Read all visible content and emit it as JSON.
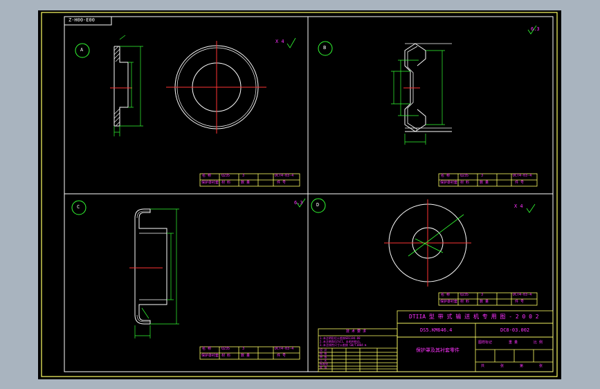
{
  "drawing_number": "Z-H00-E00",
  "titles": {
    "main": "DTIIA 型  带 式 输 送 机 专 用 图 - 2 0 0 2",
    "code_left": "DS5.KM646.4",
    "code_right": "DC8-03.002",
    "part_name": "保护罩及其衬套零件"
  },
  "views": [
    {
      "id": "A",
      "label": "A"
    },
    {
      "id": "B",
      "label": "B"
    },
    {
      "id": "C",
      "label": "C"
    },
    {
      "id": "D",
      "label": "D"
    }
  ],
  "roughness_marks": {
    "A": "X 4",
    "B": "6.3",
    "C": "6.3",
    "D": "X 4"
  },
  "view_tables": {
    "A": {
      "row1": [
        "名 称",
        "Q235",
        "3",
        "DCT4-03-4"
      ],
      "row2": [
        "保护罩衬套",
        "材 料",
        "数 量",
        "件 号"
      ]
    },
    "B": {
      "row1": [
        "名 称",
        "Q235",
        "3",
        "DCT4-03-4"
      ],
      "row2": [
        "保护罩衬套",
        "材 料",
        "数 量",
        "件 号"
      ]
    },
    "C": {
      "row1": [
        "名 称",
        "Q235",
        "3",
        "DCT4-03-4"
      ],
      "row2": [
        "保护罩衬套",
        "材 料",
        "数 量",
        "件 号"
      ]
    },
    "D": {
      "row1": [
        "名 称",
        "Q235",
        "3",
        "DCT4-03-4"
      ],
      "row2": [
        "保护罩衬套",
        "材 料",
        "数 量",
        "件 号"
      ]
    }
  },
  "tech_notes": {
    "heading": "技 术 要 求",
    "line1": "1.未注明形位公差按GB1184-80",
    "line2": "2.未注倒角均为C1，去毛刺锐边。",
    "line3": "3.未注线性尺寸公差按 GB/T1804-m"
  },
  "sign_rows": [
    "设 计",
    "校 核",
    "审 核",
    "工 艺",
    "标准化",
    "批 准"
  ],
  "scale_row": [
    "图样标记",
    "重 量",
    "比 例"
  ],
  "sheet_row": [
    "共",
    "张",
    "第",
    "张"
  ]
}
